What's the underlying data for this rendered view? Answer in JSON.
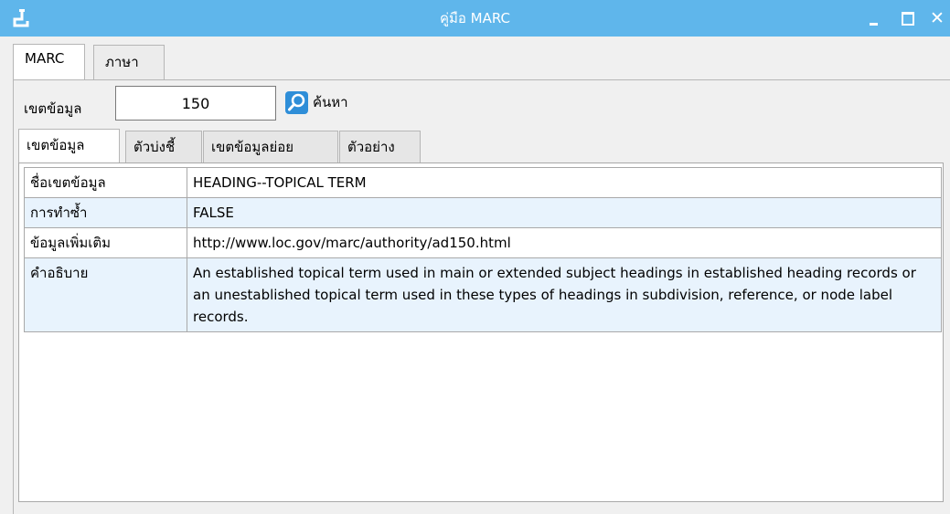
{
  "window": {
    "title": "คู่มือ MARC",
    "accent": "#5fb6eb"
  },
  "tabs_top": [
    {
      "label": "MARC",
      "active": true
    },
    {
      "label": "ภาษา",
      "active": false
    }
  ],
  "field": {
    "label": "เขตข้อมูล",
    "value": "150"
  },
  "search": {
    "label": "ค้นหา",
    "icon": "search-icon"
  },
  "tabs_inner": [
    {
      "label": "เขตข้อมูล",
      "active": true
    },
    {
      "label": "ตัวบ่งชี้",
      "active": false
    },
    {
      "label": "เขตข้อมูลย่อย",
      "active": false
    },
    {
      "label": "ตัวอย่าง",
      "active": false
    }
  ],
  "rows": [
    {
      "key": "ชื่อเขตข้อมูล",
      "value": "HEADING--TOPICAL TERM"
    },
    {
      "key": "การทำซ้ำ",
      "value": "FALSE"
    },
    {
      "key": "ข้อมูลเพิ่มเติม",
      "value": "http://www.loc.gov/marc/authority/ad150.html"
    },
    {
      "key": "คำอธิบาย",
      "value": "An established topical term used in main or extended subject headings in established heading records or an unestablished topical term used in these types of headings in subdivision, reference, or node label records."
    }
  ]
}
